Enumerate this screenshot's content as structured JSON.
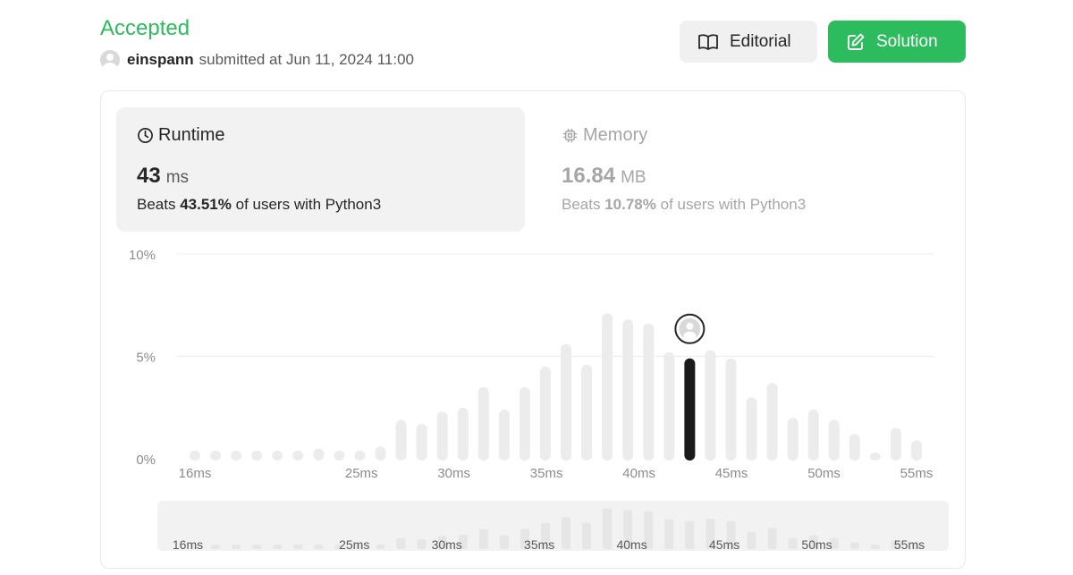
{
  "header": {
    "status": "Accepted",
    "username": "einspann",
    "submitted_text": "submitted at Jun 11, 2024 11:00",
    "editorial_label": "Editorial",
    "solution_label": "Solution"
  },
  "runtime": {
    "title": "Runtime",
    "value": "43",
    "unit": "ms",
    "beats_prefix": "Beats",
    "beats_pct": "43.51%",
    "beats_suffix": "of users with Python3"
  },
  "memory": {
    "title": "Memory",
    "value": "16.84",
    "unit": "MB",
    "beats_prefix": "Beats",
    "beats_pct": "10.78%",
    "beats_suffix": "of users with Python3"
  },
  "colors": {
    "accent": "#2cbb5d",
    "bar": "#ececec",
    "bar_highlight": "#1a1a1a"
  },
  "chart_data": {
    "type": "bar",
    "ylabel_ticks": [
      "0%",
      "5%",
      "10%"
    ],
    "ylim": [
      0,
      10
    ],
    "x_tick_labels": [
      "16ms",
      "25ms",
      "30ms",
      "35ms",
      "40ms",
      "45ms",
      "50ms",
      "55ms"
    ],
    "x": [
      16,
      18,
      20,
      22,
      24,
      26,
      27,
      28,
      29,
      30,
      31,
      32,
      33,
      34,
      35,
      36,
      37,
      38,
      39,
      40,
      41,
      42,
      43,
      44,
      45,
      46,
      47,
      48,
      49,
      50,
      51,
      52,
      53,
      54,
      55
    ],
    "values": [
      0.4,
      0.4,
      0.4,
      0.4,
      0.4,
      0.4,
      0.5,
      0.4,
      0.4,
      0.6,
      1.9,
      1.7,
      2.3,
      2.5,
      3.5,
      2.4,
      3.5,
      4.5,
      5.6,
      4.6,
      7.1,
      6.8,
      6.6,
      5.2,
      4.9,
      5.3,
      4.9,
      3.0,
      3.7,
      2.0,
      2.4,
      1.9,
      1.2,
      0.3,
      1.5,
      0.9
    ],
    "highlight_x": 43
  },
  "brush_chart": {
    "x_tick_labels": [
      "16ms",
      "25ms",
      "30ms",
      "35ms",
      "40ms",
      "45ms",
      "50ms",
      "55ms"
    ]
  }
}
